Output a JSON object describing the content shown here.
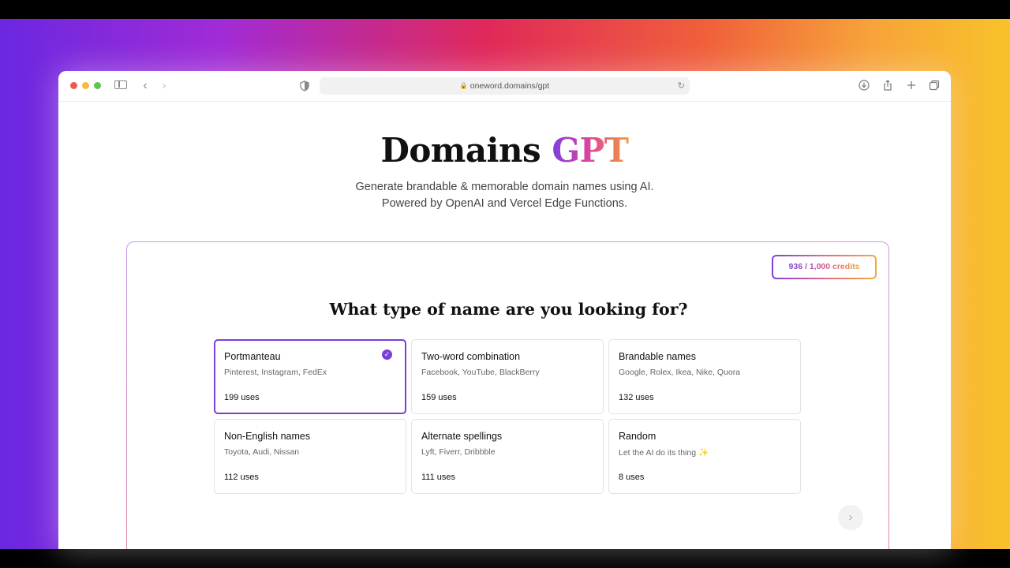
{
  "browser": {
    "url": "oneword.domains/gpt"
  },
  "hero": {
    "title_main": "Domains",
    "title_accent": "GPT",
    "subtitle_line1": "Generate brandable & memorable domain names using AI.",
    "subtitle_line2": "Powered by OpenAI and Vercel Edge Functions."
  },
  "panel": {
    "credits": "936 / 1,000 credits",
    "question": "What type of name are you looking for?",
    "options": [
      {
        "title": "Portmanteau",
        "examples": "Pinterest, Instagram, FedEx",
        "uses": "199 uses",
        "selected": true
      },
      {
        "title": "Two-word combination",
        "examples": "Facebook, YouTube, BlackBerry",
        "uses": "159 uses",
        "selected": false
      },
      {
        "title": "Brandable names",
        "examples": "Google, Rolex, Ikea, Nike, Quora",
        "uses": "132 uses",
        "selected": false
      },
      {
        "title": "Non-English names",
        "examples": "Toyota, Audi, Nissan",
        "uses": "112 uses",
        "selected": false
      },
      {
        "title": "Alternate spellings",
        "examples": "Lyft, Fiverr, Dribbble",
        "uses": "111 uses",
        "selected": false
      },
      {
        "title": "Random",
        "examples": "Let the AI do its thing ✨",
        "uses": "8 uses",
        "selected": false
      }
    ],
    "next_icon": "chevron-right-icon"
  },
  "colors": {
    "accent": "#7a3fd6",
    "gradient_start": "#7b3fe0",
    "gradient_end": "#f29a3a"
  }
}
